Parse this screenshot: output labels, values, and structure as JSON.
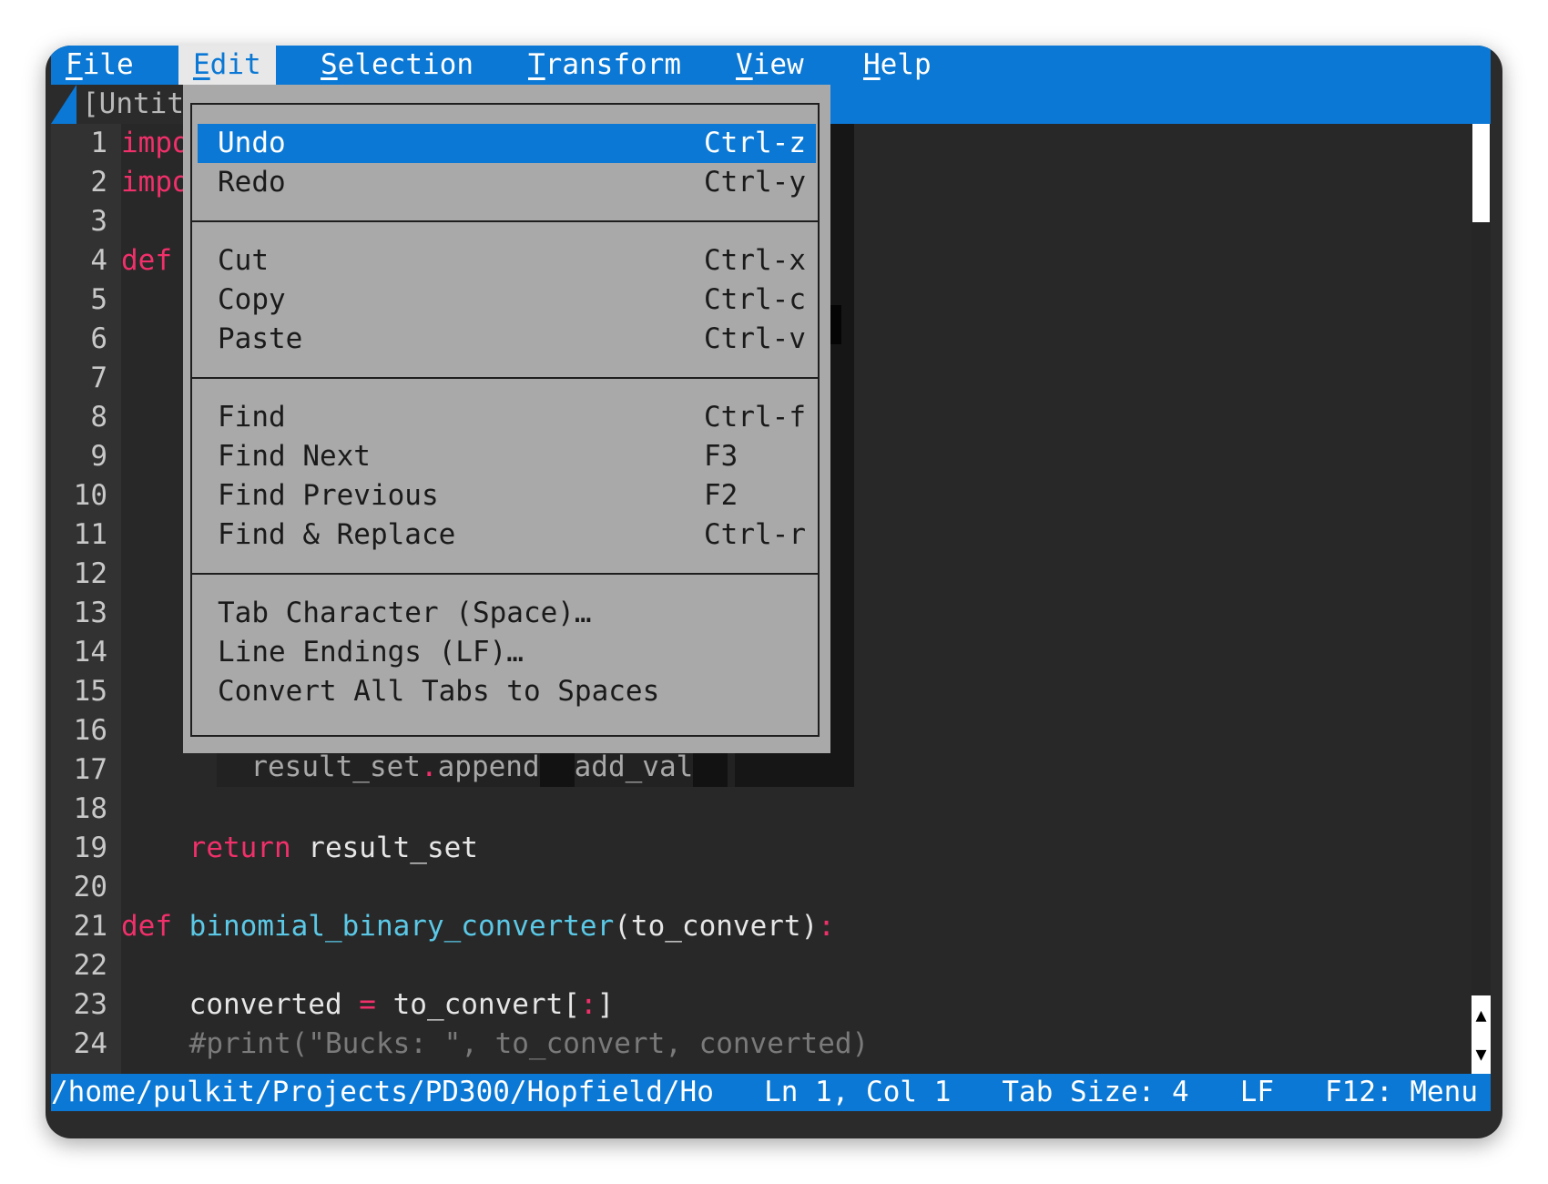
{
  "menubar": {
    "items": [
      {
        "first": "F",
        "rest": "ile"
      },
      {
        "first": "E",
        "rest": "dit"
      },
      {
        "first": "S",
        "rest": "election"
      },
      {
        "first": "T",
        "rest": "ransform"
      },
      {
        "first": "V",
        "rest": "iew"
      },
      {
        "first": "H",
        "rest": "elp"
      }
    ]
  },
  "tab": {
    "title": "[Untit"
  },
  "editor": {
    "line_numbers": [
      "1",
      "2",
      "3",
      "4",
      "5",
      "6",
      "7",
      "8",
      "9",
      "10",
      "11",
      "12",
      "13",
      "14",
      "15",
      "16",
      "17",
      "18",
      "19",
      "20",
      "21",
      "22",
      "23",
      "24"
    ],
    "line1_kw": "impo",
    "line2_kw": "impo",
    "line4_kw": "def",
    "line17": {
      "obj": "result_set",
      "dot": ".",
      "method": "append",
      "arg": "add_val"
    },
    "line19": {
      "kw": "return",
      "text": " result_set"
    },
    "line21": {
      "kw": "def",
      "fn": "binomial_binary_converter",
      "args": "(to_convert)",
      "colon": ":"
    },
    "line23": {
      "lhs": "converted ",
      "eq": "=",
      "rhs": " to_convert[",
      "colon": ":",
      "end": "]"
    },
    "line24": {
      "comment": "#print(\"Bucks: \", to_convert, converted)"
    }
  },
  "scrollbar": {
    "up_arrow": "▲",
    "down_arrow": "▼"
  },
  "statusbar": {
    "path": "/home/pulkit/Projects/PD300/Hopfield/Ho",
    "position": "Ln 1, Col 1",
    "tab_size": "Tab Size: 4",
    "line_ending": "LF",
    "menu_hint": "F12: Menu"
  },
  "edit_menu": {
    "undo": {
      "label": "Undo",
      "shortcut": "Ctrl-z"
    },
    "redo": {
      "label": "Redo",
      "shortcut": "Ctrl-y"
    },
    "cut": {
      "label": "Cut",
      "shortcut": "Ctrl-x"
    },
    "copy": {
      "label": "Copy",
      "shortcut": "Ctrl-c"
    },
    "paste": {
      "label": "Paste",
      "shortcut": "Ctrl-v"
    },
    "find": {
      "label": "Find",
      "shortcut": "Ctrl-f"
    },
    "find_next": {
      "label": "Find Next",
      "shortcut": "F3"
    },
    "find_previous": {
      "label": "Find Previous",
      "shortcut": "F2"
    },
    "find_replace": {
      "label": "Find & Replace",
      "shortcut": "Ctrl-r"
    },
    "tab_character": {
      "label": "Tab Character (Space)…"
    },
    "line_endings": {
      "label": "Line Endings (LF)…"
    },
    "convert_tabs": {
      "label": "Convert All Tabs to Spaces"
    }
  },
  "colors": {
    "accent": "#0a78d4",
    "keyword": "#f0306a",
    "function": "#5bc8e6",
    "comment": "#7a7a7a",
    "menu_bg": "#a9a9a9",
    "editor_bg": "#282828"
  }
}
